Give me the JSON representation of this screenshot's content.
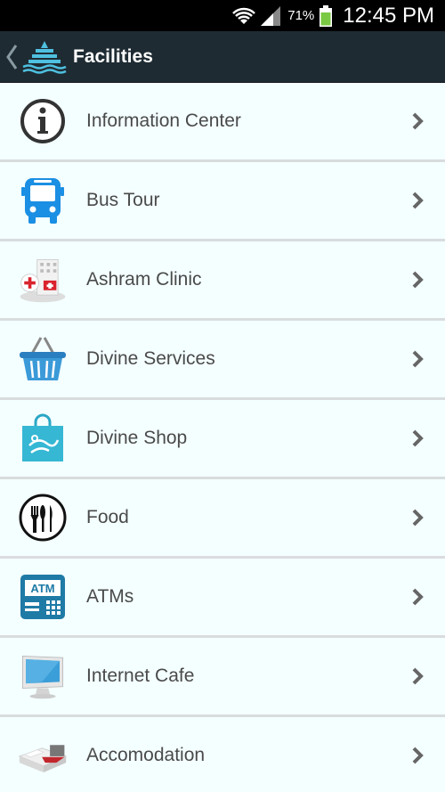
{
  "status_bar": {
    "battery_percent": "71%",
    "time": "12:45 PM"
  },
  "action_bar": {
    "title": "Facilities"
  },
  "items": [
    {
      "label": "Information Center",
      "icon": "info-icon"
    },
    {
      "label": "Bus Tour",
      "icon": "bus-icon"
    },
    {
      "label": "Ashram Clinic",
      "icon": "clinic-icon"
    },
    {
      "label": "Divine Services",
      "icon": "basket-icon"
    },
    {
      "label": "Divine Shop",
      "icon": "shopping-bag-icon"
    },
    {
      "label": "Food",
      "icon": "cutlery-icon"
    },
    {
      "label": "ATMs",
      "icon": "atm-icon"
    },
    {
      "label": "Internet Cafe",
      "icon": "monitor-icon"
    },
    {
      "label": "Accomodation",
      "icon": "bed-icon"
    }
  ]
}
